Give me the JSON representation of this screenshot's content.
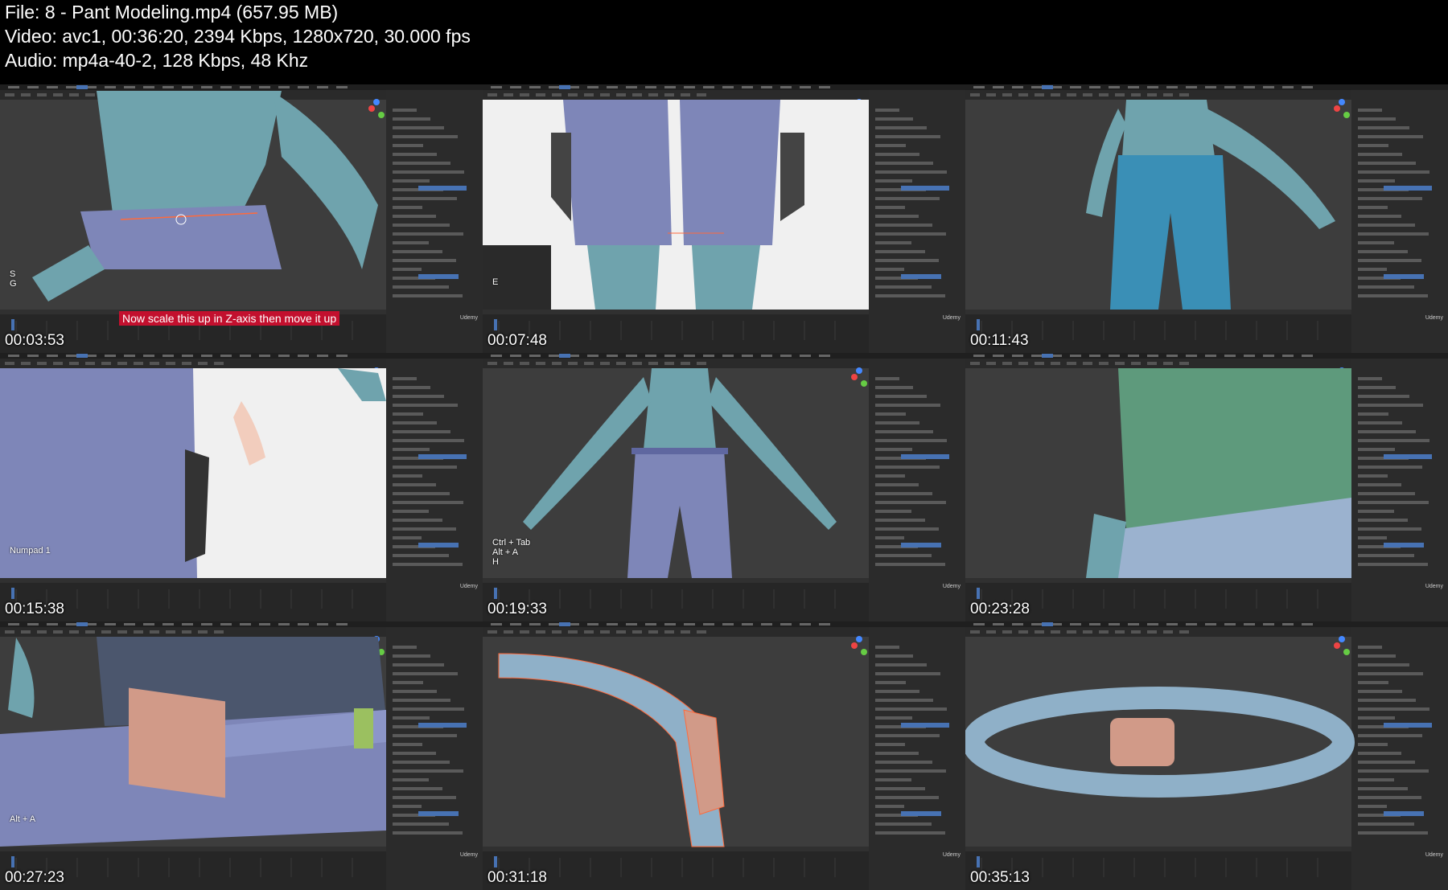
{
  "header": {
    "file_line": "File: 8 - Pant Modeling.mp4 (657.95 MB)",
    "video_line": "Video: avc1, 00:36:20, 2394 Kbps, 1280x720, 30.000 fps",
    "audio_line": "Audio: mp4a-40-2, 128 Kbps, 48 Khz"
  },
  "thumbnails": [
    {
      "timestamp": "00:03:53",
      "scene": "torso-zoom",
      "keys": "S\nG",
      "subtitle": "Now scale this up in Z-axis then move it up",
      "brand": "Udemy"
    },
    {
      "timestamp": "00:07:48",
      "scene": "legs-front-ref",
      "keys": "E",
      "subtitle": "",
      "brand": "Udemy"
    },
    {
      "timestamp": "00:11:43",
      "scene": "pants-selected",
      "keys": "",
      "subtitle": "",
      "brand": "Udemy"
    },
    {
      "timestamp": "00:15:38",
      "scene": "hip-side-ref",
      "keys": "Numpad 1",
      "subtitle": "",
      "brand": "Udemy"
    },
    {
      "timestamp": "00:19:33",
      "scene": "full-body",
      "keys": "Ctrl + Tab\nAlt + A\nH",
      "subtitle": "",
      "brand": "Udemy"
    },
    {
      "timestamp": "00:23:28",
      "scene": "closeup-green",
      "keys": "",
      "subtitle": "",
      "brand": "Udemy"
    },
    {
      "timestamp": "00:27:23",
      "scene": "belt-loop",
      "keys": "Alt + A",
      "subtitle": "",
      "brand": "Udemy"
    },
    {
      "timestamp": "00:31:18",
      "scene": "belt-buckle",
      "keys": "",
      "subtitle": "",
      "brand": "Udemy"
    },
    {
      "timestamp": "00:35:13",
      "scene": "belt-ring",
      "keys": "",
      "subtitle": "",
      "brand": "Udemy"
    }
  ],
  "colors": {
    "viewport": "#3d3d3d",
    "panel": "#2b2b2b",
    "mesh_body": "#6fa3ad",
    "mesh_pants": "#7e86b8",
    "selected_pants": "#3a8fb6",
    "buckle": "#d19a88",
    "accent": "#4772b3",
    "subtitle_bg": "#c3102e"
  }
}
